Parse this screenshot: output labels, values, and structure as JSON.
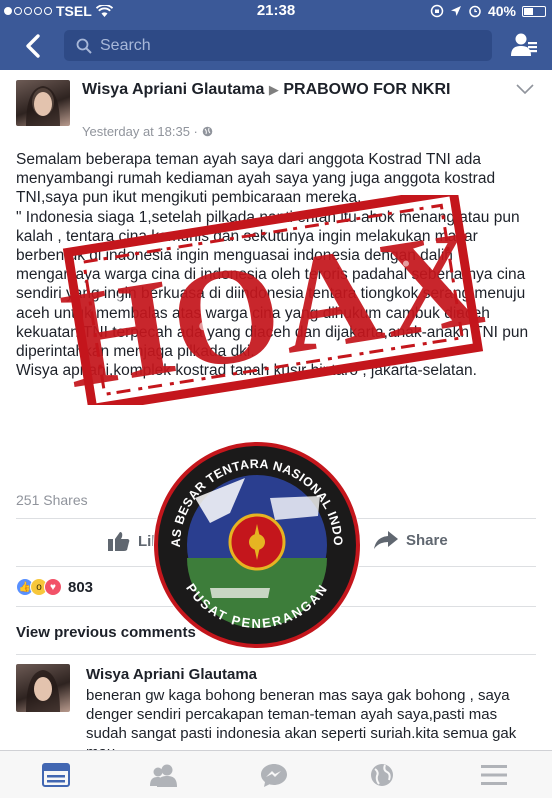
{
  "status_bar": {
    "carrier": "TSEL",
    "time": "21:38",
    "battery": "40%",
    "battery_level": 0.4
  },
  "nav": {
    "search_placeholder": "Search",
    "back_icon": "chevron-left-icon",
    "friends_icon": "friend-requests-icon"
  },
  "post": {
    "author": "Wisya Apriani Glautama",
    "target": "PRABOWO FOR NKRI",
    "timestamp": "Yesterday at 18:35 · ",
    "body": [
      "Semalam beberapa teman ayah saya dari anggota Kostrad TNI ada menyambangi rumah kediaman ayah saya yang juga anggota kostrad TNI,saya pun ikut mengikuti pembicaraan mereka.",
      "\" Indonesia siaga 1,setelah pilkada nanti entah itu ahok menang atau pun kalah , tentara cina komunis dan sekutunya ingin melakukan makar berbentuk di indonesia ingin menguasai indonesia dengan dalih menganiaya warga cina di indonesia oleh teroris padahal sebenarnya cina sendiri yang ingin berkuasa di diindonesia tentara tiongkok serang menuju aceh untuk membalas atas warga cina yang dihukum cambuk diaceh kekuatan TNI terpecah ada yang diaceh dan dijakarta,anak-anakn TNI pun diperintahkan menjaga pilkada dki.",
      "Wisya apriani,komplek kostrad tanah kusir bintaro , jakarta-selatan."
    ],
    "shares": "251 Shares",
    "like_label": "Like",
    "share_label": "Share",
    "reaction_count": "803",
    "view_previous": "View previous comments"
  },
  "comment": {
    "author": "Wisya Apriani Glautama",
    "text": "beneran gw kaga bohong beneran mas saya gak bohong , saya denger sendiri percakapan teman-teman ayah saya,pasti mas sudah sangat pasti indonesia akan seperti suriah.kita semua gak mau"
  },
  "overlay": {
    "stamp_text": "HOAX",
    "emblem_top": "MARKAS BESAR TENTARA NASIONAL INDONESIA",
    "emblem_bottom": "PUSAT PENERANGAN"
  },
  "tabs": [
    "news-feed-icon",
    "friends-icon",
    "messenger-icon",
    "notifications-globe-icon",
    "menu-icon"
  ],
  "colors": {
    "brand": "#3b5998",
    "stamp": "#c4161c",
    "text": "#1d2129",
    "meta": "#90949c"
  }
}
